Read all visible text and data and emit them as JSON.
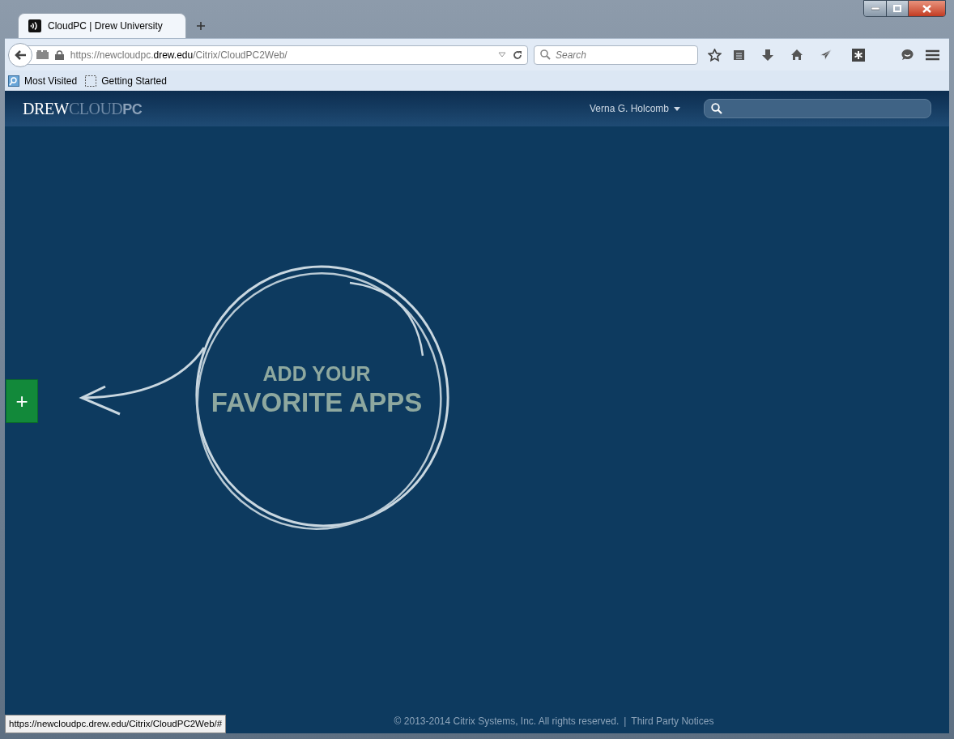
{
  "tab": {
    "title": "CloudPC | Drew University"
  },
  "address_bar": {
    "prefix": "https://newcloudpc.",
    "domain": "drew.edu",
    "path": "/Citrix/CloudPC2Web/"
  },
  "search": {
    "placeholder": "Search"
  },
  "bookmarks": [
    "Most Visited",
    "Getting Started"
  ],
  "header": {
    "logo": {
      "first": "DREW",
      "second": "CLOUD",
      "third": "PC"
    },
    "user": "Verna G. Holcomb"
  },
  "main": {
    "line_1": "ADD YOUR",
    "line_2": "FAVORITE APPS",
    "add_button": "+"
  },
  "footer": {
    "copyright": "© 2013-2014 Citrix Systems, Inc. All rights reserved.",
    "separator": "|",
    "link": "Third Party Notices"
  },
  "status_url": "https://newcloudpc.drew.edu/Citrix/CloudPC2Web/#"
}
